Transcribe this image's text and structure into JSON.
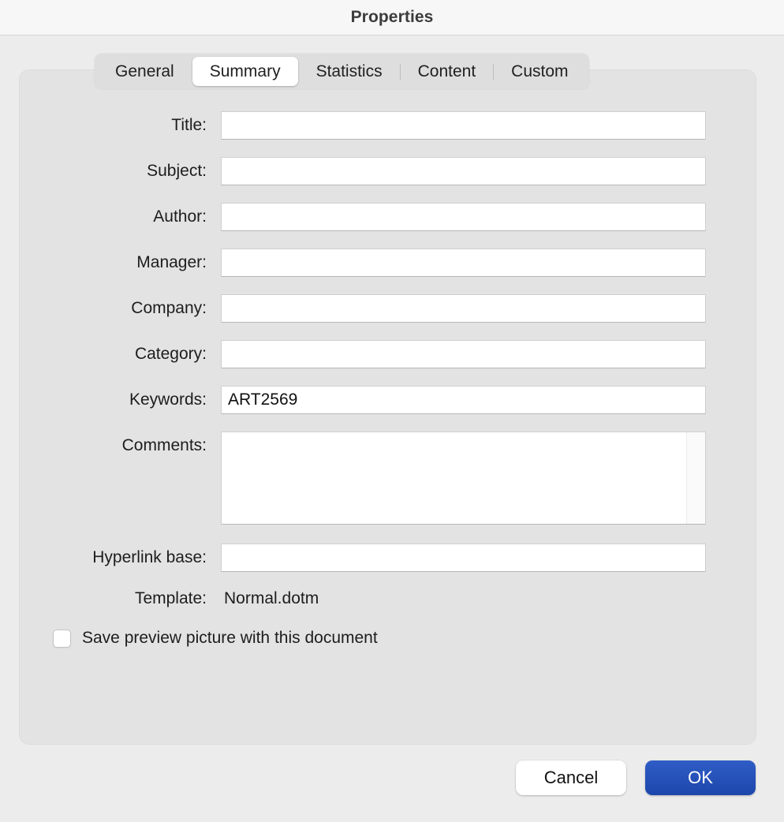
{
  "window": {
    "title": "Properties"
  },
  "tabs": [
    {
      "label": "General",
      "selected": false
    },
    {
      "label": "Summary",
      "selected": true
    },
    {
      "label": "Statistics",
      "selected": false
    },
    {
      "label": "Content",
      "selected": false
    },
    {
      "label": "Custom",
      "selected": false
    }
  ],
  "form": {
    "fields": [
      {
        "label": "Title:",
        "value": "",
        "placeholder": ""
      },
      {
        "label": "Subject:",
        "value": "",
        "placeholder": ""
      },
      {
        "label": "Author:",
        "value": "",
        "placeholder": ""
      },
      {
        "label": "Manager:",
        "value": "",
        "placeholder": ""
      },
      {
        "label": "Company:",
        "value": "",
        "placeholder": ""
      },
      {
        "label": "Category:",
        "value": "",
        "placeholder": ""
      },
      {
        "label": "Keywords:",
        "value": "ART2569",
        "placeholder": ""
      }
    ],
    "comments": {
      "label": "Comments:",
      "value": "",
      "placeholder": ""
    },
    "hyperlink_base": {
      "label": "Hyperlink base:",
      "value": "",
      "placeholder": ""
    },
    "template": {
      "label": "Template:",
      "value": "Normal.dotm"
    },
    "save_preview": {
      "label": "Save preview picture with this document",
      "checked": false
    }
  },
  "footer": {
    "cancel_label": "Cancel",
    "ok_label": "OK"
  },
  "colors": {
    "accent": "#2a55bd",
    "panel_bg": "#e3e3e3",
    "page_bg": "#ececec",
    "titlebar_bg": "#f7f7f7"
  }
}
